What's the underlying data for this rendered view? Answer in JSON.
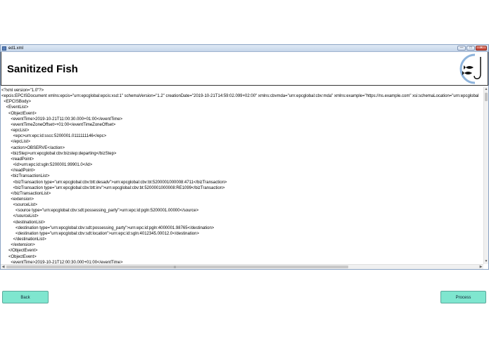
{
  "window": {
    "title": "ed1.xml",
    "controls": [
      "—",
      "□",
      "✕"
    ]
  },
  "header": {
    "title": "Sanitized Fish",
    "logo_icon": "fish-hook-logo-icon"
  },
  "xml_lines": [
    "<?xml version=\"1.0\"?>",
    "<epcis:EPCISDocument xmlns:epcis=\"urn:epcglobal:epcis:xsd:1\" schemaVersion=\"1.2\" creationDate=\"2019-10-21T14:59:02.099+02:00\" xmlns:cbvmda=\"urn:epcglobal:cbv:mda\" xmlns:example=\"https://ns.example.com\" xsi:schemaLocation=\"urn:epcglobal",
    "  <EPCISBody>",
    "    <EventList>",
    "      <ObjectEvent>",
    "        <eventTime>2019-10-21T11:00:30.000+01:00</eventTime>",
    "        <eventTimeZoneOffset>+01:00</eventTimeZoneOffset>",
    "        <epcList>",
    "          <epc>urn:epc:id:sscc:5200001.0111111146</epc>",
    "        </epcList>",
    "        <action>OBSERVE</action>",
    "        <bizStep>urn:epcglobal:cbv:bizstep:departing</bizStep>",
    "        <readPoint>",
    "          <id>urn:epc:id:sgln:5200001.99901.0</id>",
    "        </readPoint>",
    "        <bizTransactionList>",
    "          <bizTransaction type=\"urn:epcglobal:cbv:btt:desadv\">urn:epcglobal:cbv:bt:5200001000008:4711</bizTransaction>",
    "          <bizTransaction type=\"urn:epcglobal:cbv:btt:inv\">urn:epcglobal:cbv:bt:5200001000008:RE1099</bizTransaction>",
    "        </bizTransactionList>",
    "        <extension>",
    "          <sourceList>",
    "            <source type=\"urn:epcglobal:cbv:sdt:possessing_party\">urn:epc:id:pgln:5200001.00000</source>",
    "          </sourceList>",
    "          <destinationList>",
    "            <destination type=\"urn:epcglobal:cbv:sdt:possessing_party\">urn:epc:id:pgln:4000001.98765</destination>",
    "            <destination type=\"urn:epcglobal:cbv:sdt:location\">urn:epc:id:sgln:4012345.00012.0</destination>",
    "          </destinationList>",
    "        </extension>",
    "      </ObjectEvent>",
    "      <ObjectEvent>",
    "        <eventTime>2019-10-21T12:00:30.000+01:00</eventTime>"
  ],
  "footer": {
    "back_label": "Back",
    "process_label": "Process"
  },
  "colors": {
    "button_bg": "#7fe6cf",
    "logo_blue": "#8fb4dc"
  }
}
